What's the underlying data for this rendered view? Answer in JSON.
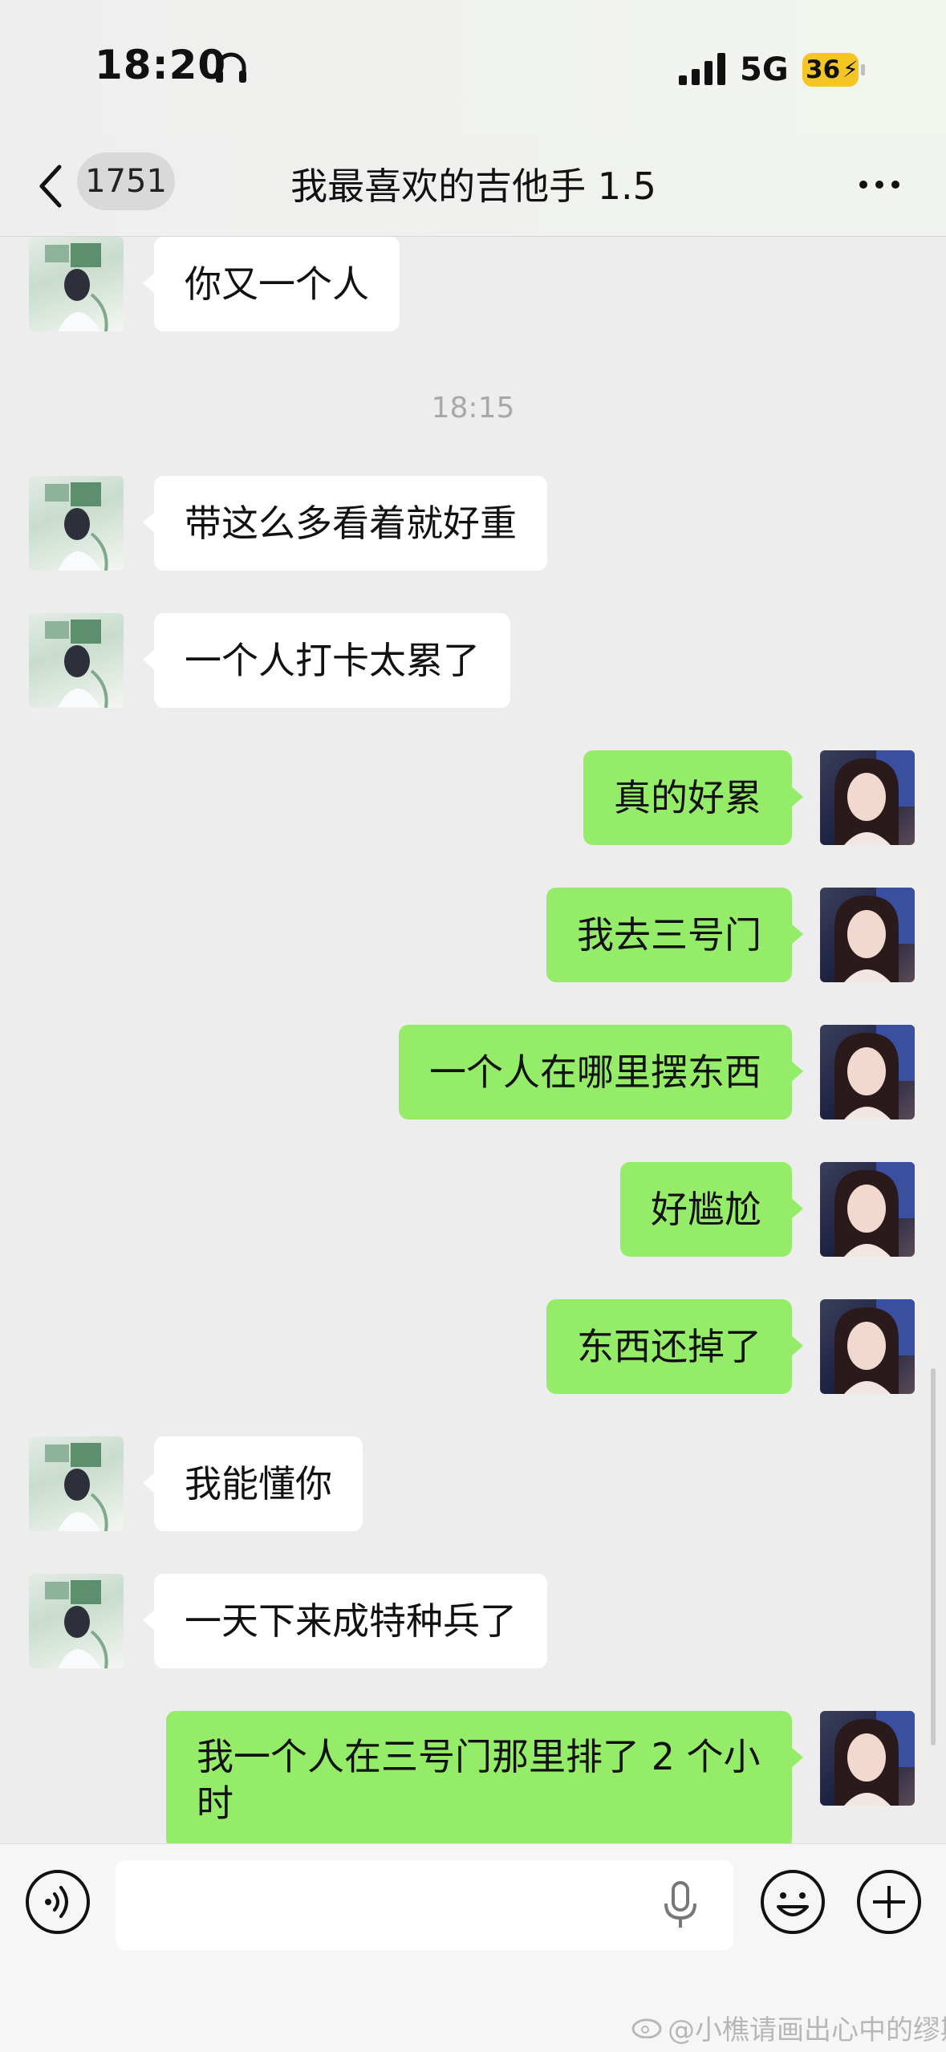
{
  "status_bar": {
    "time": "18:20",
    "network": "5G",
    "battery": "36"
  },
  "header": {
    "unread_count": "1751",
    "title": "我最喜欢的吉他手 1.5"
  },
  "messages": [
    {
      "side": "in",
      "text": "你又一个人"
    },
    {
      "type": "timestamp",
      "text": "18:15"
    },
    {
      "side": "in",
      "text": "带这么多看着就好重"
    },
    {
      "side": "in",
      "text": "一个人打卡太累了"
    },
    {
      "side": "out",
      "text": "真的好累"
    },
    {
      "side": "out",
      "text": "我去三号门"
    },
    {
      "side": "out",
      "text": "一个人在哪里摆东西"
    },
    {
      "side": "out",
      "text": "好尴尬"
    },
    {
      "side": "out",
      "text": "东西还掉了"
    },
    {
      "side": "in",
      "text": "我能懂你"
    },
    {
      "side": "in",
      "text": "一天下来成特种兵了"
    },
    {
      "side": "out",
      "text": "我一个人在三号门那里排了 2 个小时"
    }
  ],
  "input_bar": {
    "placeholder": ""
  },
  "watermark": "@小樵请画出心中的缪斯",
  "colors": {
    "background": "#ededed",
    "incoming_bubble": "#ffffff",
    "outgoing_bubble": "#95ec69",
    "battery": "#f5c623"
  },
  "icons": [
    "headphones-icon",
    "signal-icon",
    "battery-icon",
    "back-chevron-icon",
    "more-icon",
    "voice-icon",
    "mic-icon",
    "emoji-icon",
    "plus-icon",
    "weibo-icon"
  ]
}
